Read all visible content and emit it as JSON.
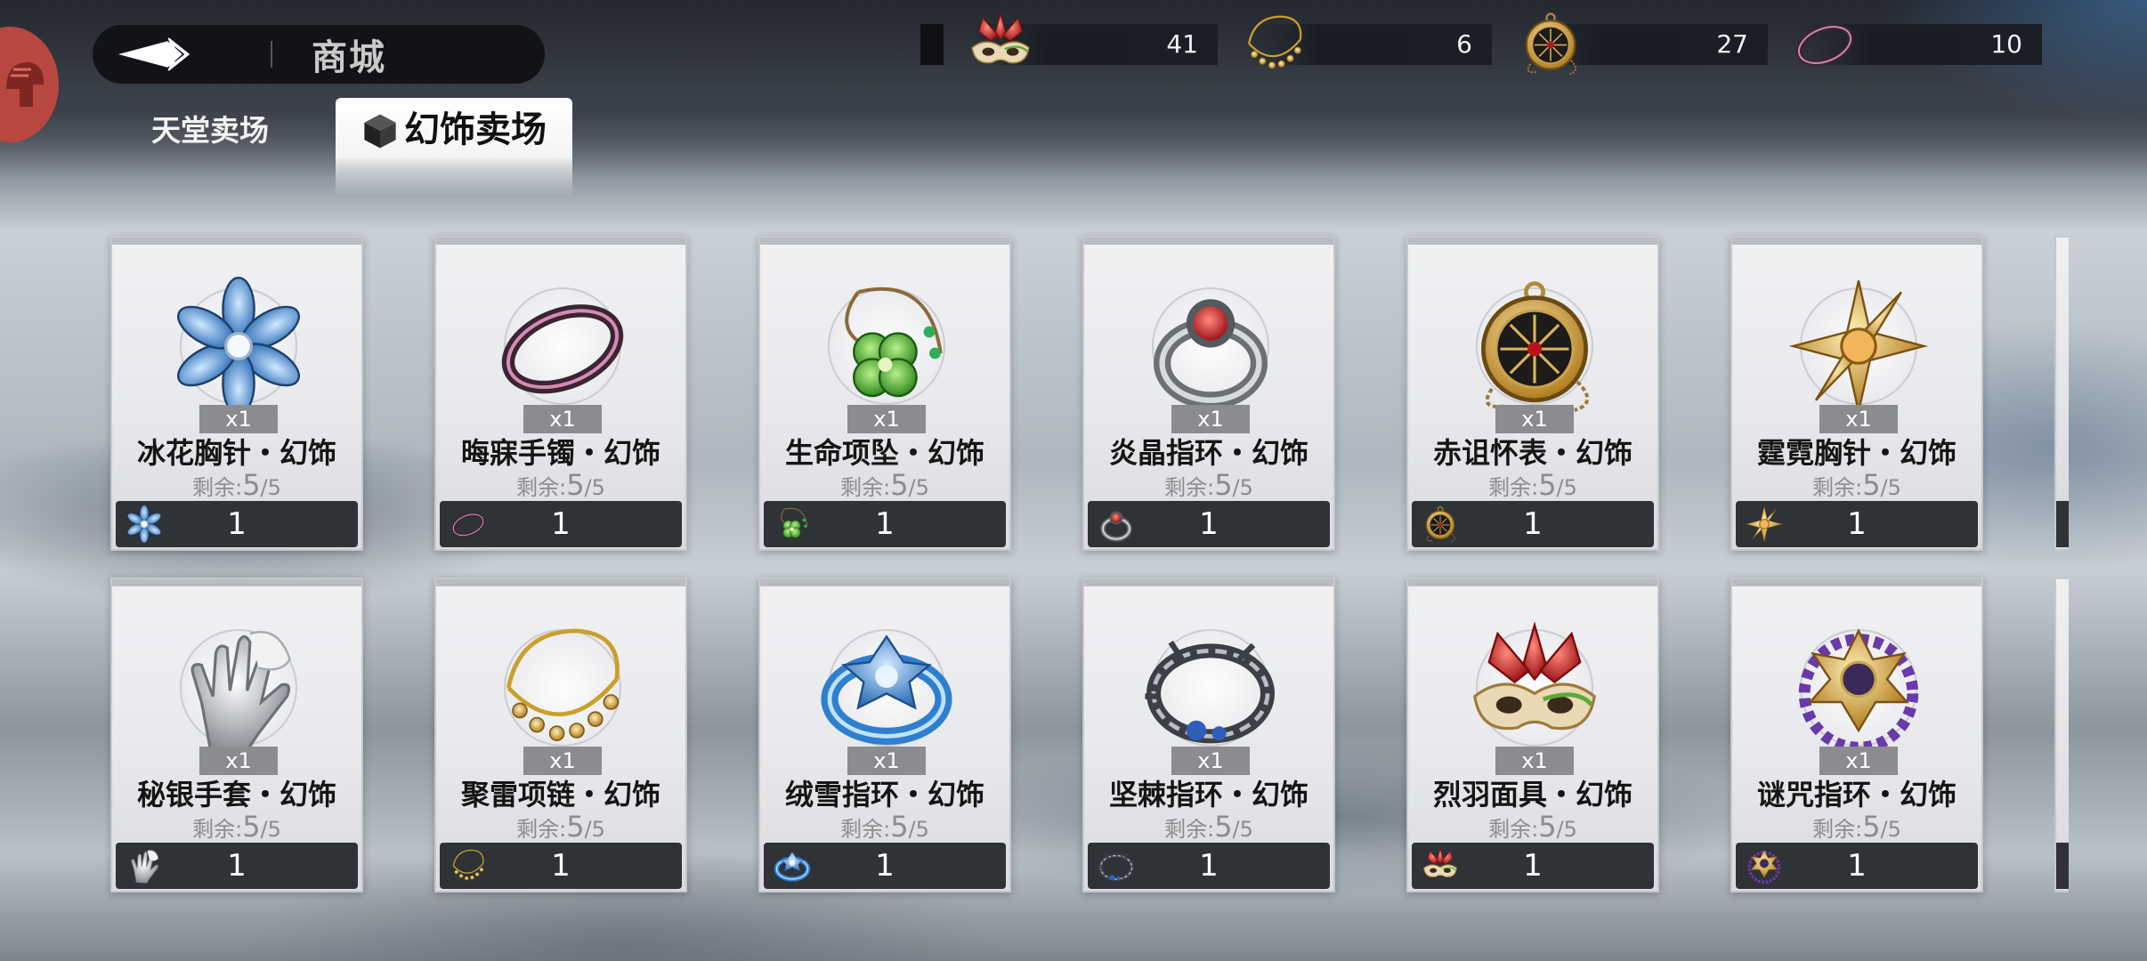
{
  "header": {
    "title": "商城"
  },
  "tabs": [
    {
      "label": "天堂卖场",
      "active": false
    },
    {
      "label": "幻饰卖场",
      "active": true
    }
  ],
  "currencies": [
    {
      "icon": "feather-mask-icon",
      "amount": "41"
    },
    {
      "icon": "gold-necklace-icon",
      "amount": "6"
    },
    {
      "icon": "pocket-watch-icon",
      "amount": "27"
    },
    {
      "icon": "dark-bracelet-icon",
      "amount": "10"
    }
  ],
  "items": [
    {
      "name": "冰花胸针・幻饰",
      "qty": "x1",
      "remain_label": "剩余:",
      "remain_current": "5",
      "remain_total": "/5",
      "price": "1",
      "icon": "snowflake-brooch-icon"
    },
    {
      "name": "晦寐手镯・幻饰",
      "qty": "x1",
      "remain_label": "剩余:",
      "remain_current": "5",
      "remain_total": "/5",
      "price": "1",
      "icon": "dark-bracelet-icon"
    },
    {
      "name": "生命项坠・幻饰",
      "qty": "x1",
      "remain_label": "剩余:",
      "remain_current": "5",
      "remain_total": "/5",
      "price": "1",
      "icon": "clover-pendant-icon"
    },
    {
      "name": "炎晶指环・幻饰",
      "qty": "x1",
      "remain_label": "剩余:",
      "remain_current": "5",
      "remain_total": "/5",
      "price": "1",
      "icon": "ruby-ring-icon"
    },
    {
      "name": "赤诅怀表・幻饰",
      "qty": "x1",
      "remain_label": "剩余:",
      "remain_current": "5",
      "remain_total": "/5",
      "price": "1",
      "icon": "pocket-watch-icon"
    },
    {
      "name": "霆霓胸针・幻饰",
      "qty": "x1",
      "remain_label": "剩余:",
      "remain_current": "5",
      "remain_total": "/5",
      "price": "1",
      "icon": "star-brooch-icon"
    },
    {
      "name": "秘银手套・幻饰",
      "qty": "x1",
      "remain_label": "剩余:",
      "remain_current": "5",
      "remain_total": "/5",
      "price": "1",
      "icon": "silver-glove-icon"
    },
    {
      "name": "聚雷项链・幻饰",
      "qty": "x1",
      "remain_label": "剩余:",
      "remain_current": "5",
      "remain_total": "/5",
      "price": "1",
      "icon": "gold-necklace-icon"
    },
    {
      "name": "绒雪指环・幻饰",
      "qty": "x1",
      "remain_label": "剩余:",
      "remain_current": "5",
      "remain_total": "/5",
      "price": "1",
      "icon": "ice-ring-icon"
    },
    {
      "name": "坚棘指环・幻饰",
      "qty": "x1",
      "remain_label": "剩余:",
      "remain_current": "5",
      "remain_total": "/5",
      "price": "1",
      "icon": "thorn-ring-icon"
    },
    {
      "name": "烈羽面具・幻饰",
      "qty": "x1",
      "remain_label": "剩余:",
      "remain_current": "5",
      "remain_total": "/5",
      "price": "1",
      "icon": "feather-mask-icon"
    },
    {
      "name": "谜咒指环・幻饰",
      "qty": "x1",
      "remain_label": "剩余:",
      "remain_current": "5",
      "remain_total": "/5",
      "price": "1",
      "icon": "amethyst-ring-icon"
    }
  ],
  "colors": {
    "card_price_bar": "#2f3237",
    "qty_badge": "#8a8c90",
    "avatar": "#b8473f"
  }
}
